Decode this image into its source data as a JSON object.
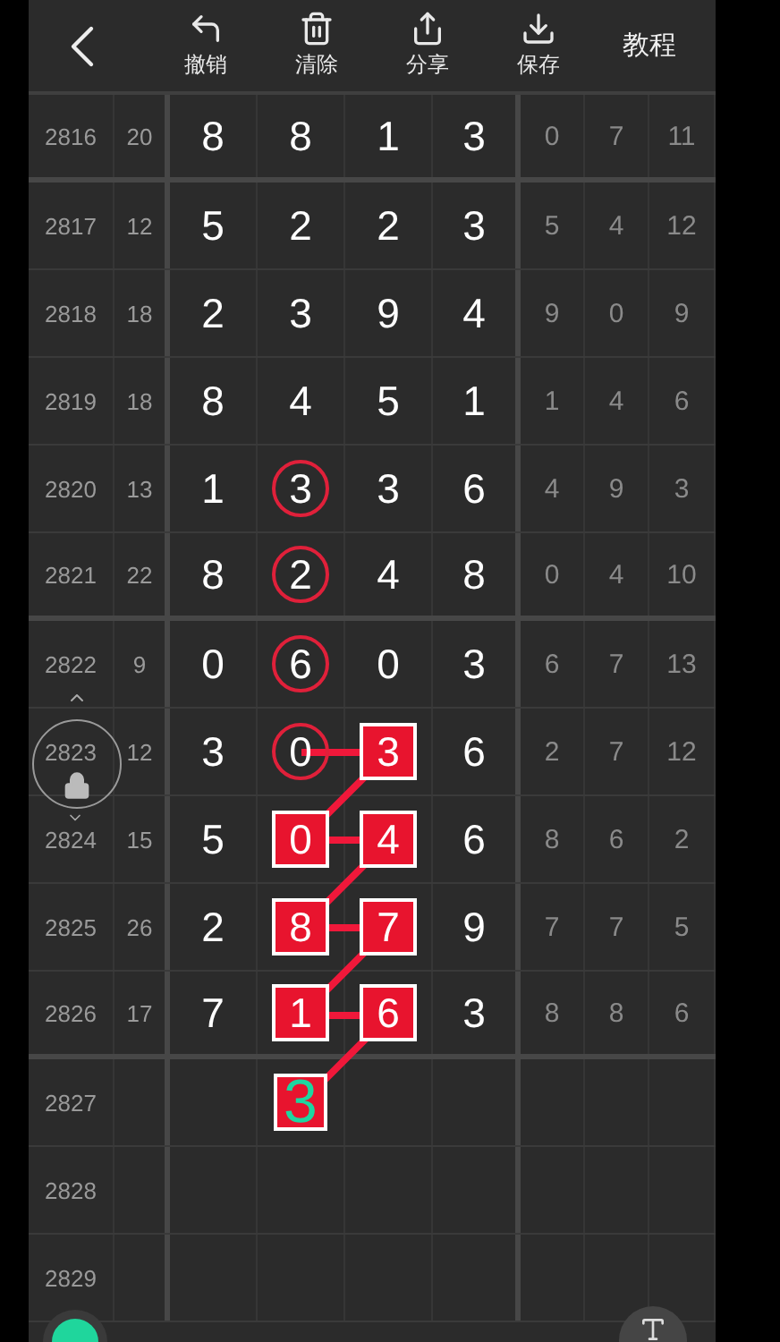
{
  "toolbar": {
    "tools": [
      {
        "kind": "undo",
        "label": "撤销"
      },
      {
        "kind": "clear",
        "label": "清除"
      },
      {
        "kind": "share",
        "label": "分享"
      },
      {
        "kind": "save",
        "label": "保存"
      }
    ],
    "tutorial": "教程"
  },
  "rows": [
    {
      "issue": "2816",
      "sum": "20",
      "digits": [
        {
          "kind": "plain",
          "value": "8"
        },
        {
          "kind": "plain",
          "value": "8"
        },
        {
          "kind": "plain",
          "value": "1"
        },
        {
          "kind": "plain",
          "value": "3"
        }
      ],
      "tail": [
        "0",
        "7",
        "11"
      ]
    },
    {
      "issue": "2817",
      "sum": "12",
      "digits": [
        {
          "kind": "plain",
          "value": "5"
        },
        {
          "kind": "plain",
          "value": "2"
        },
        {
          "kind": "plain",
          "value": "2"
        },
        {
          "kind": "plain",
          "value": "3"
        }
      ],
      "tail": [
        "5",
        "4",
        "12"
      ]
    },
    {
      "issue": "2818",
      "sum": "18",
      "digits": [
        {
          "kind": "plain",
          "value": "2"
        },
        {
          "kind": "plain",
          "value": "3"
        },
        {
          "kind": "plain",
          "value": "9"
        },
        {
          "kind": "plain",
          "value": "4"
        }
      ],
      "tail": [
        "9",
        "0",
        "9"
      ]
    },
    {
      "issue": "2819",
      "sum": "18",
      "digits": [
        {
          "kind": "plain",
          "value": "8"
        },
        {
          "kind": "plain",
          "value": "4"
        },
        {
          "kind": "plain",
          "value": "5"
        },
        {
          "kind": "plain",
          "value": "1"
        }
      ],
      "tail": [
        "1",
        "4",
        "6"
      ]
    },
    {
      "issue": "2820",
      "sum": "13",
      "digits": [
        {
          "kind": "plain",
          "value": "1"
        },
        {
          "kind": "circle",
          "value": "3"
        },
        {
          "kind": "plain",
          "value": "3"
        },
        {
          "kind": "plain",
          "value": "6"
        }
      ],
      "tail": [
        "4",
        "9",
        "3"
      ]
    },
    {
      "issue": "2821",
      "sum": "22",
      "digits": [
        {
          "kind": "plain",
          "value": "8"
        },
        {
          "kind": "circle",
          "value": "2"
        },
        {
          "kind": "plain",
          "value": "4"
        },
        {
          "kind": "plain",
          "value": "8"
        }
      ],
      "tail": [
        "0",
        "4",
        "10"
      ]
    },
    {
      "issue": "2822",
      "sum": "9",
      "digits": [
        {
          "kind": "plain",
          "value": "0"
        },
        {
          "kind": "circle",
          "value": "6"
        },
        {
          "kind": "plain",
          "value": "0"
        },
        {
          "kind": "plain",
          "value": "3"
        }
      ],
      "tail": [
        "6",
        "7",
        "13"
      ]
    },
    {
      "issue": "2823",
      "sum": "12",
      "digits": [
        {
          "kind": "plain",
          "value": "3"
        },
        {
          "kind": "circle",
          "value": "0",
          "linked": true
        },
        {
          "kind": "box",
          "value": "3",
          "linked": true
        },
        {
          "kind": "plain",
          "value": "6"
        }
      ],
      "tail": [
        "2",
        "7",
        "12"
      ]
    },
    {
      "issue": "2824",
      "sum": "15",
      "digits": [
        {
          "kind": "plain",
          "value": "5"
        },
        {
          "kind": "box",
          "value": "0",
          "linked": true
        },
        {
          "kind": "box",
          "value": "4",
          "linked": true
        },
        {
          "kind": "plain",
          "value": "6"
        }
      ],
      "tail": [
        "8",
        "6",
        "2"
      ]
    },
    {
      "issue": "2825",
      "sum": "26",
      "digits": [
        {
          "kind": "plain",
          "value": "2"
        },
        {
          "kind": "box",
          "value": "8",
          "linked": true
        },
        {
          "kind": "box",
          "value": "7",
          "linked": true
        },
        {
          "kind": "plain",
          "value": "9"
        }
      ],
      "tail": [
        "7",
        "7",
        "5"
      ]
    },
    {
      "issue": "2826",
      "sum": "17",
      "digits": [
        {
          "kind": "plain",
          "value": "7"
        },
        {
          "kind": "box",
          "value": "1",
          "linked": true
        },
        {
          "kind": "box",
          "value": "6",
          "linked": true
        },
        {
          "kind": "plain",
          "value": "3"
        }
      ],
      "tail": [
        "8",
        "8",
        "6"
      ]
    },
    {
      "issue": "2827",
      "digits": [
        {
          "kind": "empty"
        },
        {
          "kind": "guess",
          "value": "3",
          "linked": true
        },
        {
          "kind": "empty"
        },
        {
          "kind": "empty"
        }
      ]
    },
    {
      "issue": "2828"
    },
    {
      "issue": "2829"
    }
  ]
}
